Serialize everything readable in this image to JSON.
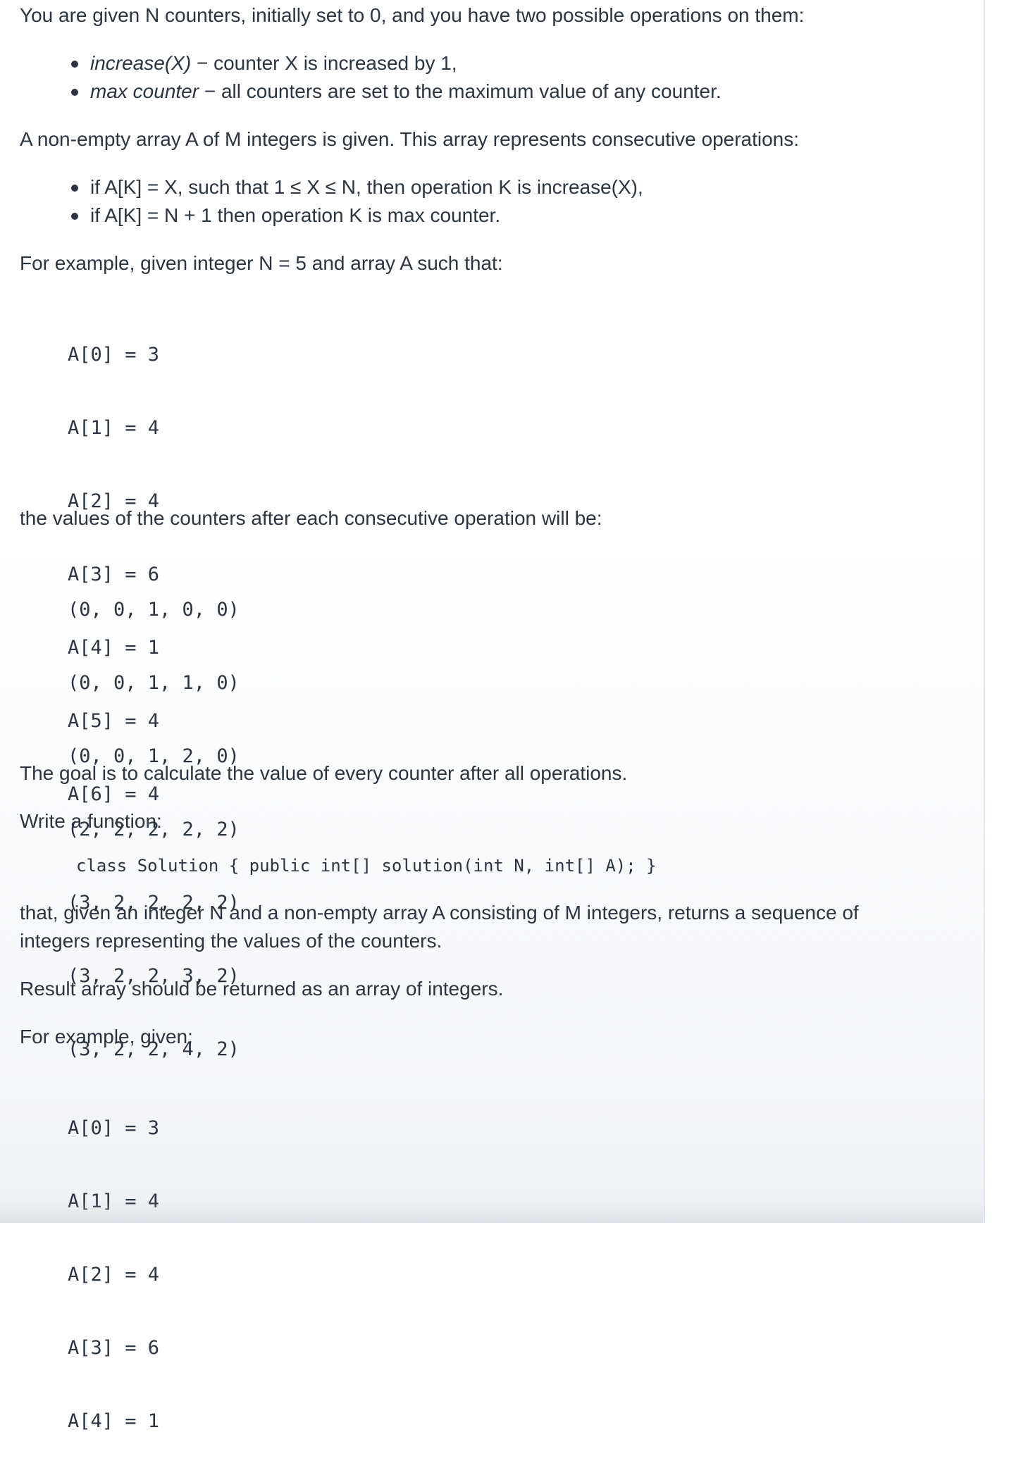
{
  "intro": "You are given N counters, initially set to 0, and you have two possible operations on them:",
  "operations": [
    {
      "name": "increase(X)",
      "desc": " − counter X is increased by 1,"
    },
    {
      "name": "max counter",
      "desc": " − all counters are set to the maximum value of any counter."
    }
  ],
  "array_intro": "A non-empty array A of M integers is given. This array represents consecutive operations:",
  "conditions": [
    "if A[K] = X, such that 1 ≤ X ≤ N, then operation K is increase(X),",
    "if A[K] = N + 1 then operation K is max counter."
  ],
  "example_intro": "For example, given integer N = 5 and array A such that:",
  "example_array": [
    "A[0] = 3",
    "A[1] = 4",
    "A[2] = 4",
    "A[3] = 6",
    "A[4] = 1",
    "A[5] = 4",
    "A[6] = 4"
  ],
  "counters_intro": "the values of the counters after each consecutive operation will be:",
  "counter_states": [
    "(0, 0, 1, 0, 0)",
    "(0, 0, 1, 1, 0)",
    "(0, 0, 1, 2, 0)",
    "(2, 2, 2, 2, 2)",
    "(3, 2, 2, 2, 2)",
    "(3, 2, 2, 3, 2)",
    "(3, 2, 2, 4, 2)"
  ],
  "goal": "The goal is to calculate the value of every counter after all operations.",
  "write_function": "Write a function:",
  "signature": "class Solution { public int[] solution(int N, int[] A); }",
  "returns_line1": "that, given an integer N and a non-empty array A consisting of M integers, returns a sequence of",
  "returns_line2": "integers representing the values of the counters.",
  "result_note": "Result array should be returned as an array of integers.",
  "example2_intro": "For example, given:",
  "example2_array": [
    "A[0] = 3",
    "A[1] = 4",
    "A[2] = 4",
    "A[3] = 6",
    "A[4] = 1"
  ]
}
